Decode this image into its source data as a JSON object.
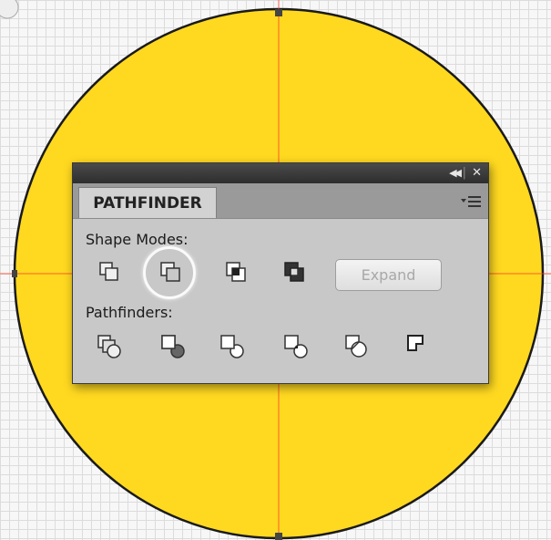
{
  "canvas": {
    "fill_color": "#FFD920",
    "outline_color": "#1a1a1a",
    "guide_color": "#ff3b2a",
    "grid_color": "#dcdcdc"
  },
  "panel": {
    "tab_label": "PATHFINDER",
    "title_controls": {
      "collapse_icon": "double-chevron-left-icon",
      "close_icon": "close-icon"
    },
    "shape_modes_label": "Shape Modes:",
    "shape_modes": [
      {
        "name": "unite",
        "icon": "unite-icon"
      },
      {
        "name": "minus-front",
        "icon": "minus-front-icon",
        "highlighted": true
      },
      {
        "name": "intersect",
        "icon": "intersect-icon"
      },
      {
        "name": "exclude",
        "icon": "exclude-icon"
      }
    ],
    "expand_label": "Expand",
    "pathfinders_label": "Pathfinders:",
    "pathfinders": [
      {
        "name": "divide",
        "icon": "divide-icon"
      },
      {
        "name": "trim",
        "icon": "trim-icon"
      },
      {
        "name": "merge",
        "icon": "merge-icon"
      },
      {
        "name": "crop",
        "icon": "crop-icon"
      },
      {
        "name": "outline",
        "icon": "outline-icon"
      },
      {
        "name": "minus-back",
        "icon": "minus-back-icon"
      }
    ]
  }
}
